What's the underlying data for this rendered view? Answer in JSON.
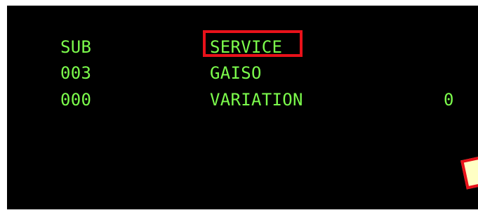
{
  "colors": {
    "screen_background": "#000000",
    "text": "#7cfc4c",
    "highlight_border": "#e8111a",
    "note_fill": "#ffffc4",
    "note_border": "#e8111a"
  },
  "terminal": {
    "rows": [
      {
        "code": "SUB",
        "label": "SERVICE",
        "value": ""
      },
      {
        "code": "003",
        "label": "GAISO",
        "value": ""
      },
      {
        "code": "000",
        "label": "VARIATION",
        "value": "0"
      }
    ]
  }
}
